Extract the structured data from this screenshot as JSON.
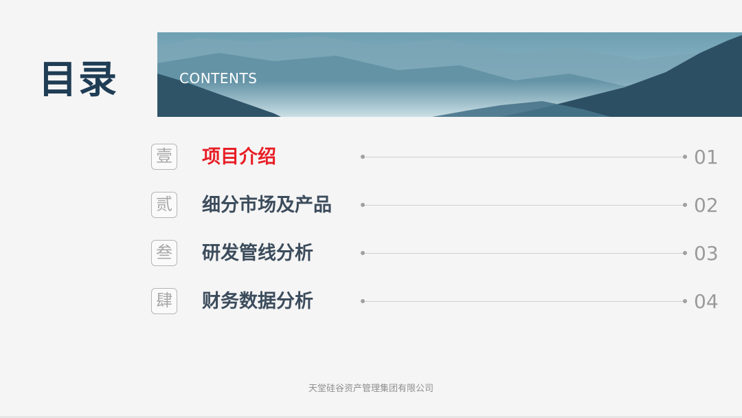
{
  "slide": {
    "title": "目录",
    "banner_label": "CONTENTS",
    "items": [
      {
        "badge": "壹",
        "label": "项目介绍",
        "number": "01",
        "active": true
      },
      {
        "badge": "贰",
        "label": "细分市场及产品",
        "number": "02",
        "active": false
      },
      {
        "badge": "叁",
        "label": "研发管线分析",
        "number": "03",
        "active": false
      },
      {
        "badge": "肆",
        "label": "财务数据分析",
        "number": "04",
        "active": false
      }
    ],
    "footer": "天堂硅谷资产管理集团有限公司"
  },
  "colors": {
    "title": "#1f3d55",
    "active_item": "#e81d25",
    "item": "#3c4c5c",
    "badge": "#a8a8a8"
  }
}
